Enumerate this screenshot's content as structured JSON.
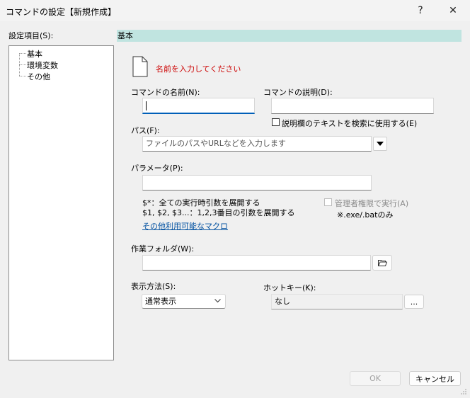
{
  "window": {
    "title": "コマンドの設定【新規作成】",
    "help_glyph": "?",
    "close_glyph": "✕"
  },
  "tree": {
    "label": "設定項目(S):",
    "items": [
      "基本",
      "環境変数",
      "その他"
    ]
  },
  "section": {
    "header": "基本"
  },
  "message": {
    "text": "名前を入力してください"
  },
  "fields": {
    "name_label": "コマンドの名前(N):",
    "name_value": "",
    "desc_label": "コマンドの説明(D):",
    "desc_value": "",
    "use_desc_search_label": "説明欄のテキストを検索に使用する(E)",
    "path_label": "パス(F):",
    "path_placeholder": "ファイルのパスやURLなどを入力します",
    "param_label": "パラメータ(P):",
    "param_value": "",
    "param_help_1": "$*：全ての実行時引数を展開する",
    "param_help_2": "$1, $2, $3...：1,2,3番目の引数を展開する",
    "macro_link": "その他利用可能なマクロ",
    "admin_label": "管理者権限で実行(A)",
    "admin_note": "※.exe/.batのみ",
    "workdir_label": "作業フォルダ(W):",
    "workdir_value": "",
    "display_label": "表示方法(S):",
    "display_value": "通常表示",
    "hotkey_label": "ホットキー(K):",
    "hotkey_value": "なし",
    "hotkey_button": "..."
  },
  "buttons": {
    "ok": "OK",
    "cancel": "キャンセル"
  },
  "colors": {
    "section_header": "#c0e4e0",
    "link": "#0050a0",
    "error": "#cc0000",
    "focus": "#005fb8"
  }
}
